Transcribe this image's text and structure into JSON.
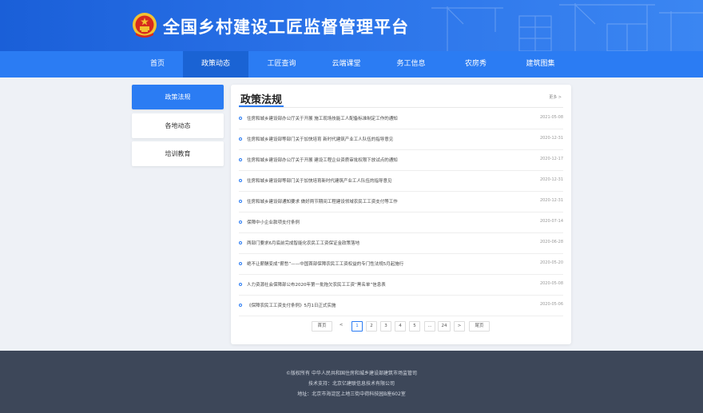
{
  "header": {
    "site_title": "全国乡村建设工匠监督管理平台"
  },
  "nav": {
    "items": [
      {
        "label": "首页"
      },
      {
        "label": "政策动态"
      },
      {
        "label": "工匠查询"
      },
      {
        "label": "云端课堂"
      },
      {
        "label": "务工信息"
      },
      {
        "label": "农房秀"
      },
      {
        "label": "建筑图集"
      }
    ],
    "active_index": 1
  },
  "sidebar": {
    "items": [
      {
        "label": "政策法规"
      },
      {
        "label": "各地动态"
      },
      {
        "label": "培训教育"
      }
    ],
    "active_index": 0
  },
  "main": {
    "title": "政策法规",
    "more_label": "更多 >",
    "news": [
      {
        "title": "住房和城乡建设部办公厅关于开展 施工现场技能工人配备标准制定工作的通知",
        "date": "2021-05-08"
      },
      {
        "title": "住房和城乡建设部等部门关于加快培育 新时代建筑产业工人队伍的指导意见",
        "date": "2020-12-31"
      },
      {
        "title": "住房和城乡建设部办公厅关于开展 建设工程企业资质审批权限下放试点的通知",
        "date": "2020-12-17"
      },
      {
        "title": "住房和城乡建设部等部门关于加快培育新时代建筑产业工人队伍的指导意见",
        "date": "2020-12-31"
      },
      {
        "title": "住房和城乡建设部通知要求 做好两节期间工程建设领域农民工工资支付等工作",
        "date": "2020-12-31"
      },
      {
        "title": "保障中小企业款项支付条例",
        "date": "2020-07-14"
      },
      {
        "title": "两部门要求6月底前完成智能化农民工工资保证金政策落地",
        "date": "2020-06-28"
      },
      {
        "title": "绝不让薪酬变成“薪愁”——中国首部保障农民工工资权益的专门性法规5月起施行",
        "date": "2020-05-20"
      },
      {
        "title": "人力资源社会保障部公布2020年第一批拖欠农民工工资“黑名单”信息表",
        "date": "2020-05-08"
      },
      {
        "title": "《保障农民工工资支付条例》5月1日正式实施",
        "date": "2020-05-06"
      }
    ],
    "pagination": {
      "first": "首页",
      "prev": "<",
      "pages": [
        "1",
        "2",
        "3",
        "4",
        "5"
      ],
      "ellipsis": "...",
      "last_page": "24",
      "next": ">",
      "last": "尾页",
      "current": "1"
    }
  },
  "footer": {
    "copyright": "©版权所有 中华人民共和国住房和城乡建设部建筑市场监管司",
    "tech_support": "技术支持：北京亿建联信息技术有限公司",
    "address": "地址：北京市海淀区上地三街中荷科技园B座602室"
  },
  "colors": {
    "primary": "#2b7cf3",
    "nav_active": "#1a63d4",
    "footer_bg": "#3d4759",
    "page_bg": "#eef1f6"
  }
}
